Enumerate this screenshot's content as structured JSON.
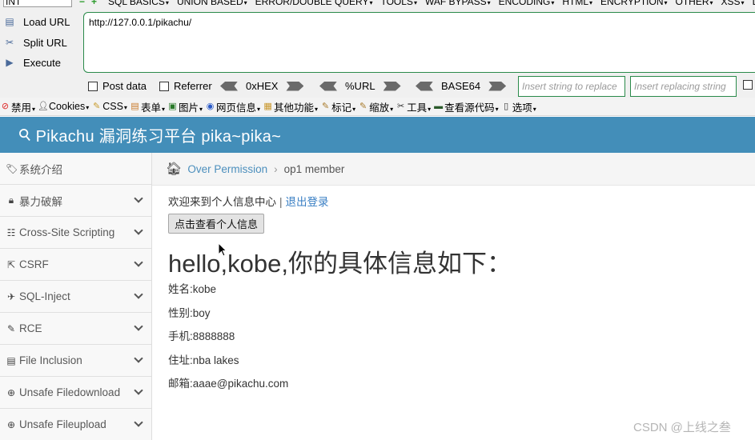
{
  "hackbar": {
    "type_select": "INT",
    "menus": [
      "SQL BASICS",
      "UNION BASED",
      "ERROR/DOUBLE QUERY",
      "TOOLS",
      "WAF BYPASS",
      "ENCODING",
      "HTML",
      "ENCRYPTION",
      "OTHER",
      "XSS",
      "L"
    ],
    "buttons": {
      "load": "Load URL",
      "split": "Split URL",
      "execute": "Execute"
    },
    "url": "http://127.0.0.1/pikachu/",
    "options": {
      "post_data": "Post data",
      "referrer": "Referrer"
    },
    "encoders": [
      "0xHEX",
      "%URL",
      "BASE64"
    ],
    "insert_placeholder": "Insert string to replace",
    "replacing_placeholder": "Insert replacing string"
  },
  "toolbar": {
    "items": [
      {
        "icon": "ban-icon",
        "label": "禁用"
      },
      {
        "icon": "user-icon",
        "label": "Cookies"
      },
      {
        "icon": "pencil-icon",
        "label": "CSS"
      },
      {
        "icon": "form-icon",
        "label": "表单"
      },
      {
        "icon": "image-icon",
        "label": "图片"
      },
      {
        "icon": "info-icon",
        "label": "网页信息"
      },
      {
        "icon": "misc-icon",
        "label": "其他功能"
      },
      {
        "icon": "marker-icon",
        "label": "标记"
      },
      {
        "icon": "resize-icon",
        "label": "缩放"
      },
      {
        "icon": "tools-icon",
        "label": "工具"
      },
      {
        "icon": "source-icon",
        "label": "查看源代码"
      },
      {
        "icon": "options-icon",
        "label": "选项"
      }
    ]
  },
  "header": {
    "title": "Pikachu 漏洞练习平台 pika~pika~"
  },
  "sidebar": {
    "items": [
      {
        "icon": "tags-icon",
        "label": "系统介绍",
        "chevron": false
      },
      {
        "icon": "lock-icon",
        "label": "暴力破解",
        "chevron": true
      },
      {
        "icon": "list-icon",
        "label": "Cross-Site Scripting",
        "chevron": true
      },
      {
        "icon": "share-icon",
        "label": "CSRF",
        "chevron": true
      },
      {
        "icon": "plane-icon",
        "label": "SQL-Inject",
        "chevron": true
      },
      {
        "icon": "wrench-icon",
        "label": "RCE",
        "chevron": true
      },
      {
        "icon": "file-icon",
        "label": "File Inclusion",
        "chevron": true
      },
      {
        "icon": "download-icon",
        "label": "Unsafe Filedownload",
        "chevron": true
      },
      {
        "icon": "upload-icon",
        "label": "Unsafe Fileupload",
        "chevron": true
      }
    ]
  },
  "breadcrumb": {
    "link": "Over Permission",
    "current": "op1 member"
  },
  "main": {
    "welcome": "欢迎来到个人信息中心",
    "separator": "|",
    "logout": "退出登录",
    "view_button": "点击查看个人信息",
    "hello": "hello,kobe,你的具体信息如下：",
    "fields": [
      "姓名:kobe",
      "性别:boy",
      "手机:8888888",
      "住址:nba lakes",
      "邮箱:aaae@pikachu.com"
    ]
  },
  "watermark": "CSDN @上线之叁"
}
